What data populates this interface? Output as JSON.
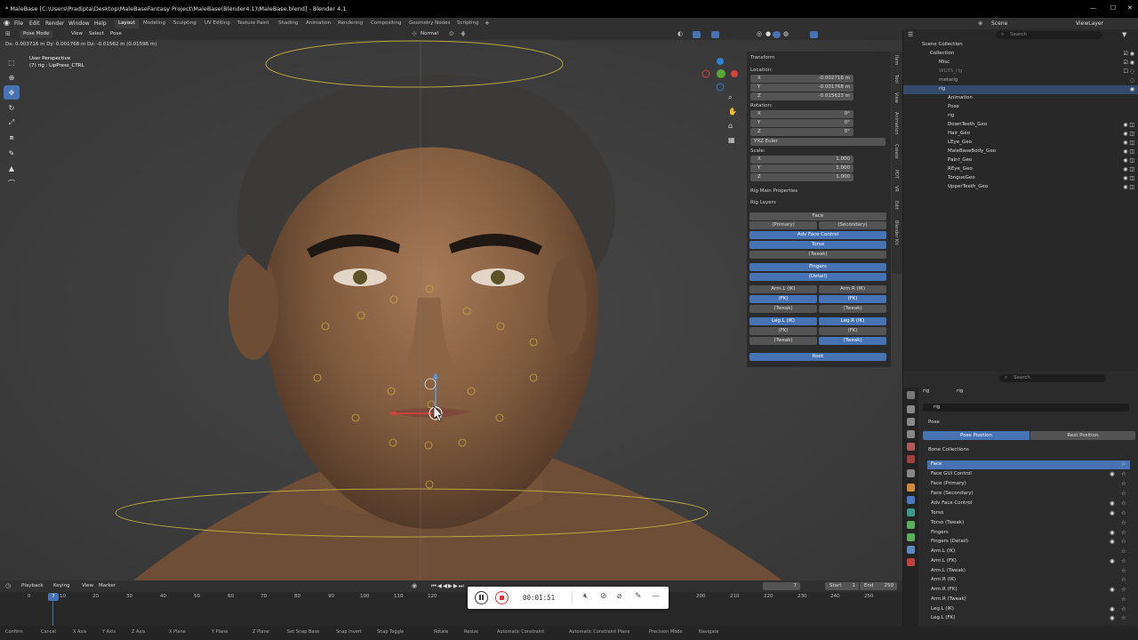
{
  "titlebar": {
    "title": "* MaleBase [C:\\Users\\Pradipta\\Desktop\\MaleBaseFantasy Project\\MaleBase(Blender4.1)\\MaleBase.blend] - Blender 4.1",
    "minimize": "—",
    "maximize": "☐",
    "close": "✕"
  },
  "menu": {
    "logo": "◉",
    "file": "File",
    "edit": "Edit",
    "render": "Render",
    "window": "Window",
    "help": "Help",
    "workspaces": [
      "Layout",
      "Modeling",
      "Sculpting",
      "UV Editing",
      "Texture Paint",
      "Shading",
      "Animation",
      "Rendering",
      "Compositing",
      "Geometry Nodes",
      "Scripting"
    ],
    "add_tab": "+",
    "scene": "Scene",
    "viewlayer": "ViewLayer"
  },
  "viewport_header": {
    "mode": "Pose Mode",
    "view": "View",
    "select": "Select",
    "pose": "Pose",
    "orientation": "Normal",
    "transform_info": "Dx: 0.003716 m   Dy: 0.001768 m   Dz: -0.01562 m (0.01596 m)"
  },
  "viewport": {
    "perspective": "User Perspective",
    "active": "(7) rig : LipPress_CTRL"
  },
  "tools": [
    "⬚",
    "⊕",
    "✥",
    "↻",
    "⤢",
    "⧈",
    "✎",
    "▲",
    "⌒"
  ],
  "npanel": {
    "transform": "Transform",
    "location": "Location:",
    "loc": [
      {
        "k": "X",
        "v": "-0.002716 m"
      },
      {
        "k": "Y",
        "v": "-0.001768 m"
      },
      {
        "k": "Z",
        "v": "-0.015623 m"
      }
    ],
    "rotation": "Rotation:",
    "rot": [
      {
        "k": "X",
        "v": "0°"
      },
      {
        "k": "Y",
        "v": "0°"
      },
      {
        "k": "Z",
        "v": "0°"
      }
    ],
    "rotation_mode": "YXZ Euler",
    "scale": "Scale:",
    "scl": [
      {
        "k": "X",
        "v": "1.000"
      },
      {
        "k": "Y",
        "v": "1.000"
      },
      {
        "k": "Z",
        "v": "1.000"
      }
    ],
    "rig_main": "Rig Main Properties",
    "rig_layers": "Rig Layers",
    "layers": {
      "face": "Face",
      "primary": "(Primary)",
      "secondary": "(Secondary)",
      "adv_face": "Adv Face Control",
      "torso": "Torso",
      "torso_tweak": "(Tweak)",
      "fingers": "Fingers",
      "fingers_detail": "(Detail)",
      "arm_l_ik": "Arm.L (IK)",
      "arm_r_ik": "Arm.R (IK)",
      "arm_l_fk": "(FK)",
      "arm_r_fk": "(FK)",
      "arm_l_tweak": "(Tweak)",
      "arm_r_tweak": "(Tweak)",
      "leg_l_ik": "Leg.L (IK)",
      "leg_r_ik": "Leg.R (IK)",
      "leg_l_fk": "(FK)",
      "leg_r_fk": "(FK)",
      "leg_l_tweak": "(Tweak)",
      "leg_r_tweak": "(Tweak)",
      "root": "Root"
    }
  },
  "sidetabs": [
    "Item",
    "Tool",
    "View",
    "Animation",
    "Create",
    "PDT",
    "VR",
    "Edit",
    "Blender Kit"
  ],
  "outliner": {
    "search_placeholder": "Search",
    "rows": [
      {
        "label": "Scene Collection",
        "indent": 0
      },
      {
        "label": "Collection",
        "indent": 1
      },
      {
        "label": "Misc",
        "indent": 2
      },
      {
        "label": "WGTS_rig",
        "indent": 2
      },
      {
        "label": "metarig",
        "indent": 2
      },
      {
        "label": "rig",
        "indent": 2
      },
      {
        "label": "Animation",
        "indent": 3
      },
      {
        "label": "Pose",
        "indent": 3
      },
      {
        "label": "rig",
        "indent": 3
      },
      {
        "label": "DownTeeth_Geo",
        "indent": 3
      },
      {
        "label": "Hair_Geo",
        "indent": 3
      },
      {
        "label": "LEye_Geo",
        "indent": 3
      },
      {
        "label": "MaleBaseBody_Geo",
        "indent": 3
      },
      {
        "label": "Paint_Geo",
        "indent": 3
      },
      {
        "label": "REye_Geo",
        "indent": 3
      },
      {
        "label": "TongueGeo",
        "indent": 3
      },
      {
        "label": "UpperTeeth_Geo",
        "indent": 3
      }
    ]
  },
  "properties": {
    "search_placeholder": "Search",
    "breadcrumb_obj": "rig",
    "breadcrumb_data": "rig",
    "name_field": "rig",
    "pose_section": "Pose",
    "pose_position": "Pose Position",
    "rest_position": "Rest Position",
    "bone_collections": "Bone Collections",
    "collections": [
      "Face",
      "Face GUI Control",
      "Face (Primary)",
      "Face (Secondary)",
      "Adv Face Control",
      "Torso",
      "Torso (Tweak)",
      "Fingers",
      "Fingers (Detail)",
      "Arm.L (IK)",
      "Arm.L (FK)",
      "Arm.L (Tweak)",
      "Arm.R (IK)",
      "Arm.R (FK)",
      "Arm.R (Tweak)",
      "Leg.L (IK)",
      "Leg.L (FK)"
    ]
  },
  "timeline": {
    "playback": "Playback",
    "keying": "Keying",
    "view": "View",
    "marker": "Marker",
    "current_frame": "7",
    "start_label": "Start",
    "start": "1",
    "end_label": "End",
    "end": "250",
    "ticks": [
      "0",
      "10",
      "20",
      "30",
      "40",
      "50",
      "60",
      "70",
      "80",
      "90",
      "100",
      "110",
      "120",
      "200",
      "210",
      "220",
      "230",
      "240",
      "250"
    ],
    "cursor_frame": "7"
  },
  "recorder": {
    "time": "00:01:51"
  },
  "statusbar": [
    "Confirm",
    "Cancel",
    "X Axis",
    "Y Axis",
    "Z Axis",
    "X Plane",
    "Y Plane",
    "Z Plane",
    "Set Snap Base",
    "Snap Invert",
    "Snap Toggle",
    "Rotate",
    "Resize",
    "Automatic Constraint",
    "Automatic Constraint Plane",
    "Precision Mode",
    "Navigate"
  ],
  "colors": {
    "accent": "#4772b3",
    "selected_row": "#344a6a",
    "panel": "#2b2b2b",
    "header": "#303030"
  }
}
